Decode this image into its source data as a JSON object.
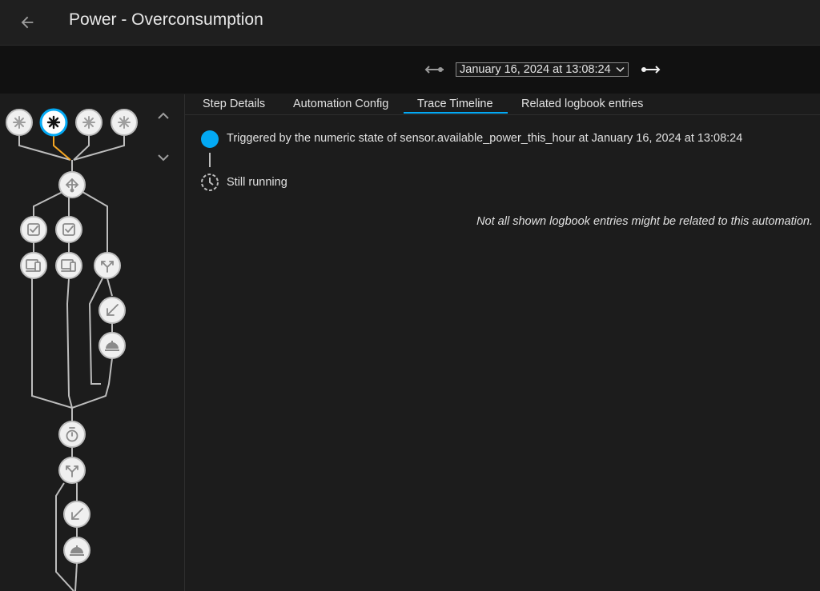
{
  "header": {
    "title": "Power - Overconsumption",
    "back_icon": "arrow-left-icon"
  },
  "trace_nav": {
    "selected_trace": "January 16, 2024 at 13:08:24",
    "prev_icon": "previous-trace-icon",
    "next_icon": "next-trace-icon",
    "dropdown_icon": "chevron-down-icon"
  },
  "tabs": [
    {
      "label": "Step Details"
    },
    {
      "label": "Automation Config"
    },
    {
      "label": "Trace Timeline",
      "active": true
    },
    {
      "label": "Related logbook entries"
    }
  ],
  "timeline": {
    "trigger_text": "Triggered by the numeric state of sensor.available_power_this_hour at January 16, 2024 at 13:08:24",
    "status_text": "Still running",
    "note": "Not all shown logbook entries might be related to this automation."
  },
  "graph": {
    "active_color": "#03a9f4",
    "path_color": "#f5a623",
    "line_color": "#bdbdbd",
    "node_fill": "#f0f0f0",
    "nodes": [
      {
        "name": "trigger-node-1",
        "icon": "asterisk-icon"
      },
      {
        "name": "trigger-node-2",
        "icon": "asterisk-icon",
        "active": true
      },
      {
        "name": "trigger-node-3",
        "icon": "asterisk-icon"
      },
      {
        "name": "trigger-node-4",
        "icon": "asterisk-icon"
      },
      {
        "name": "choose-node",
        "icon": "arrow-decision-icon"
      },
      {
        "name": "condition-node-1",
        "icon": "check-box-icon"
      },
      {
        "name": "condition-node-2",
        "icon": "check-box-icon"
      },
      {
        "name": "device-node-1",
        "icon": "devices-icon"
      },
      {
        "name": "device-node-2",
        "icon": "devices-icon"
      },
      {
        "name": "if-node-1",
        "icon": "call-split-icon"
      },
      {
        "name": "then-node-1",
        "icon": "arrow-bottom-left-icon"
      },
      {
        "name": "service-node-1",
        "icon": "room-service-icon"
      },
      {
        "name": "delay-node",
        "icon": "timer-icon"
      },
      {
        "name": "if-node-2",
        "icon": "call-split-icon"
      },
      {
        "name": "then-node-2",
        "icon": "arrow-bottom-left-icon"
      },
      {
        "name": "service-node-2",
        "icon": "room-service-icon"
      }
    ],
    "scroll_up_icon": "chevron-up-icon",
    "scroll_down_icon": "chevron-down-icon"
  }
}
